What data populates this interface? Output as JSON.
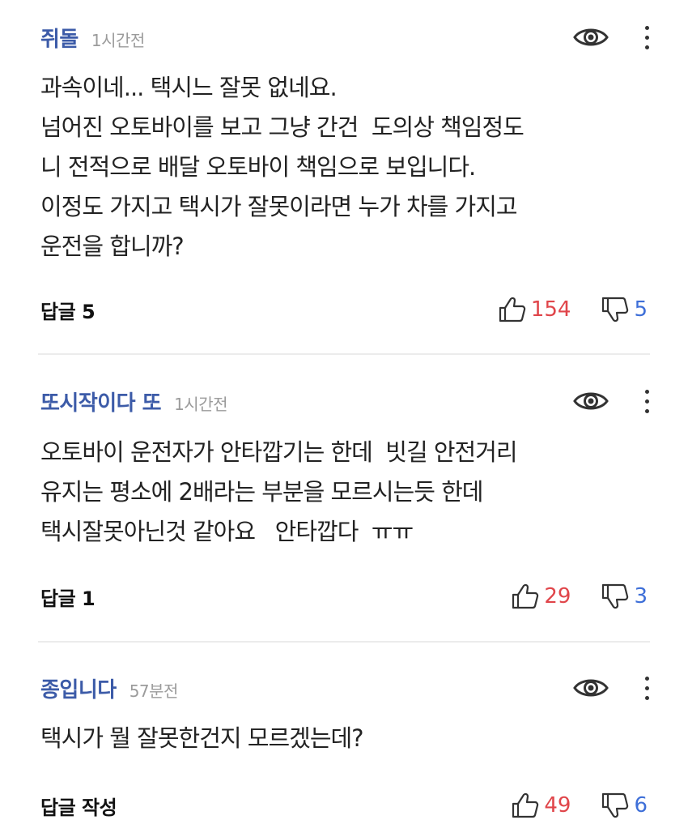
{
  "comments": [
    {
      "author": "쥐돌",
      "time": "1시간전",
      "lines": [
        "과속이네... 택시느 잘못 없네요.",
        "넘어진 오토바이를 보고 그냥 간건  도의상 책임정도",
        "니 전적으로 배달 오토바이 책임으로 보입니다.",
        "이정도 가지고 택시가 잘못이라면 누가 차를 가지고",
        "운전을 합니까?"
      ],
      "reply_label": "답글 5",
      "likes": "154",
      "dislikes": "5"
    },
    {
      "author": "또시작이다 또",
      "time": "1시간전",
      "lines": [
        "오토바이 운전자가 안타깝기는 한데  빗길 안전거리",
        "유지는 평소에 2배라는 부분을 모르시는듯 한데",
        "택시잘못아닌것 같아요   안타깝다  ㅠㅠ"
      ],
      "reply_label": "답글 1",
      "likes": "29",
      "dislikes": "3"
    },
    {
      "author": "종입니다",
      "time": "57분전",
      "lines": [
        "택시가 뭘 잘못한건지 모르겠는데?"
      ],
      "reply_label": "답글 작성",
      "likes": "49",
      "dislikes": "6"
    }
  ],
  "colors": {
    "author": "#3c5ba8",
    "like": "#e0454a",
    "dislike": "#3e6fd8",
    "divider": "#ececec"
  },
  "icons": {
    "view": "eye-icon",
    "menu": "more-vertical-icon",
    "like": "thumbs-up-icon",
    "dislike": "thumbs-down-icon"
  }
}
